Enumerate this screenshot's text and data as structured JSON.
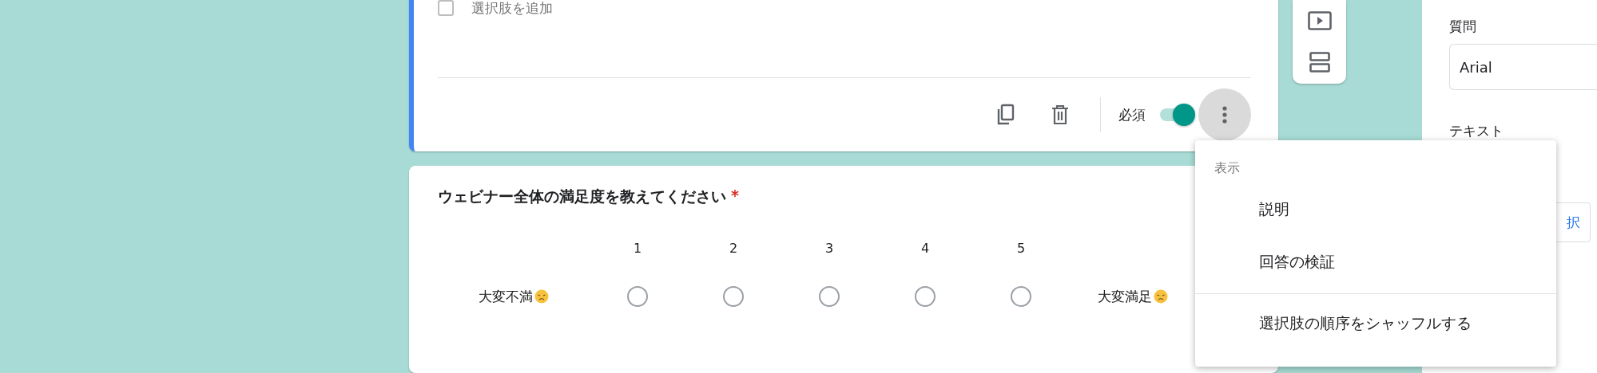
{
  "question_card": {
    "add_option_checked": false,
    "add_option": "選択肢を追加",
    "required_label": "必須",
    "required_on": true
  },
  "scale_card": {
    "title": "ウェビナー全体の満足度を教えてください",
    "required_mark": "*",
    "min_label": "大変不満",
    "max_label": "大変満足",
    "options": [
      {
        "label": "1",
        "selected": false
      },
      {
        "label": "2",
        "selected": false
      },
      {
        "label": "3",
        "selected": false
      },
      {
        "label": "4",
        "selected": false
      },
      {
        "label": "5",
        "selected": false
      }
    ]
  },
  "side_panel": {
    "question_label": "質問",
    "font": "Arial",
    "text_label": "テキスト",
    "button_fragment": "択"
  },
  "menu": {
    "items": [
      {
        "kind": "header",
        "label": "表示"
      },
      {
        "kind": "item",
        "label": "説明"
      },
      {
        "kind": "item",
        "label": "回答の検証"
      },
      {
        "kind": "divider"
      },
      {
        "kind": "item",
        "label": "選択肢の順序をシャッフルする"
      }
    ]
  }
}
